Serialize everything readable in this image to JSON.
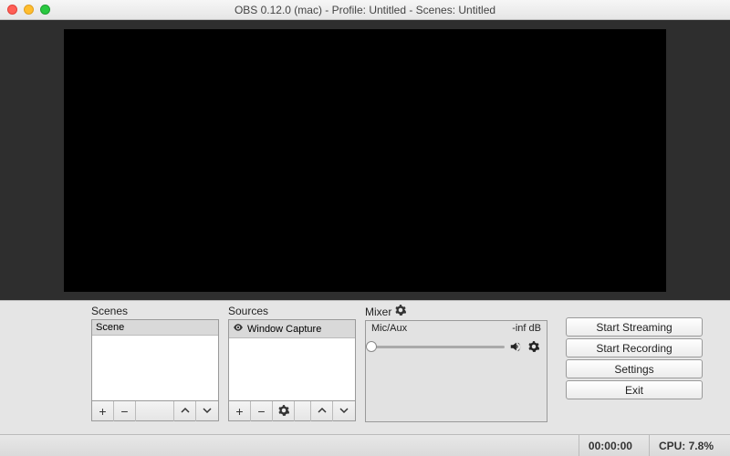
{
  "titlebar": {
    "title": "OBS 0.12.0 (mac) - Profile: Untitled - Scenes: Untitled"
  },
  "panels": {
    "scenes": {
      "label": "Scenes",
      "item": "Scene"
    },
    "sources": {
      "label": "Sources",
      "item": "Window Capture"
    },
    "mixer": {
      "label": "Mixer",
      "channel": "Mic/Aux",
      "level": "-inf dB"
    }
  },
  "buttons": {
    "start_streaming": "Start Streaming",
    "start_recording": "Start Recording",
    "settings": "Settings",
    "exit": "Exit"
  },
  "status": {
    "time": "00:00:00",
    "cpu": "CPU: 7.8%"
  }
}
